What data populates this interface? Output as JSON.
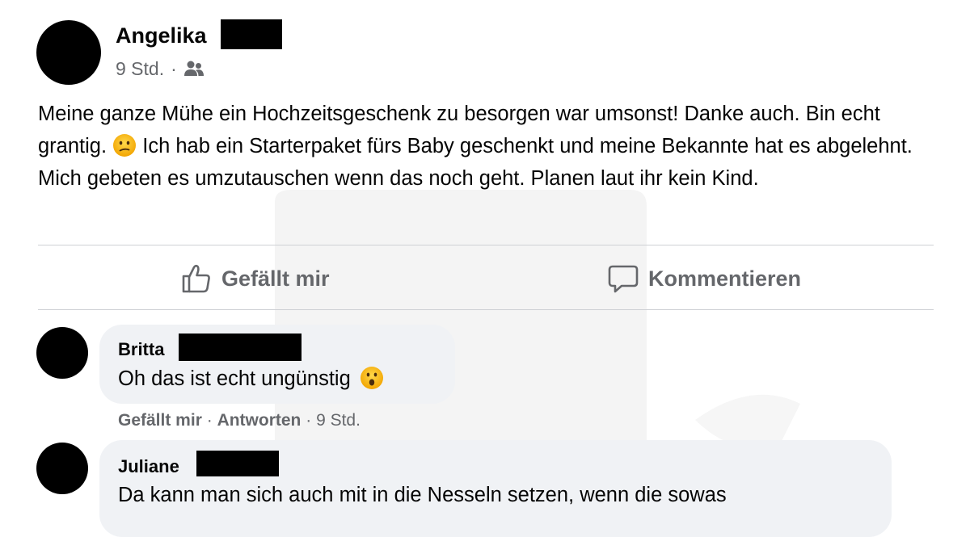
{
  "post": {
    "author": "Angelika",
    "time": "9 Std.",
    "separator": "·",
    "audience_icon": "friends-icon",
    "text_part1": "Meine ganze Mühe ein Hochzeitsgeschenk zu besorgen war umsonst! Danke auch. Bin echt grantig.",
    "emoji1": "confused-face-emoji",
    "text_part2": "Ich hab ein Starterpaket fürs Baby geschenkt und meine Bekannte hat es abgelehnt. Mich gebeten es umzutauschen wenn das noch geht. Planen laut ihr kein Kind."
  },
  "actions": {
    "like_label": "Gefällt mir",
    "like_icon": "thumbs-up-icon",
    "comment_label": "Kommentieren",
    "comment_icon": "speech-bubble-icon"
  },
  "comments": [
    {
      "author": "Britta",
      "text": "Oh das ist echt ungünstig",
      "emoji": "astonished-face-emoji",
      "like_label": "Gefällt mir",
      "reply_label": "Antworten",
      "time": "9 Std.",
      "separator": "·"
    },
    {
      "author": "Juliane",
      "text": "Da kann man sich auch mit in die Nesseln setzen, wenn die sowas"
    }
  ],
  "colors": {
    "secondary_text": "#65676b",
    "bubble_bg": "#f0f2f5",
    "divider": "#ced0d4",
    "emoji_yellow": "#f7b500"
  }
}
